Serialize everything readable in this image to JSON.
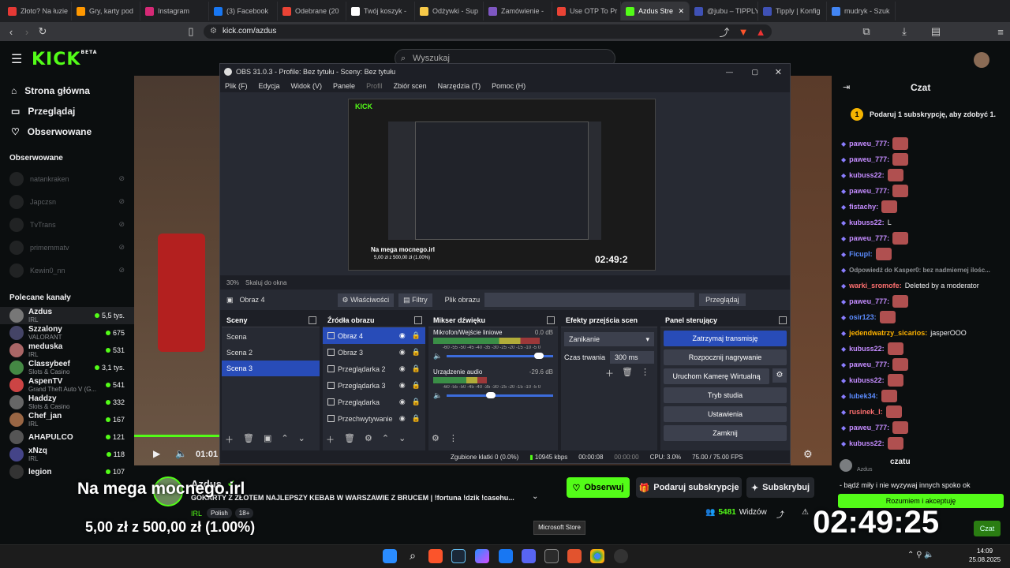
{
  "browser": {
    "tabs": [
      {
        "label": "Złoto? Na łuzie",
        "color": "#e53935"
      },
      {
        "label": "Gry, karty pod",
        "color": "#ff9800"
      },
      {
        "label": "Instagram",
        "color": "#d62976"
      },
      {
        "label": "(3) Facebook",
        "color": "#1877f2"
      },
      {
        "label": "Odebrane (20",
        "color": "#ea4335"
      },
      {
        "label": "Twój koszyk - ",
        "color": "#ffffff"
      },
      {
        "label": "Odżywki - Sup",
        "color": "#f7c948"
      },
      {
        "label": "Zamówienie - ",
        "color": "#7e57c2"
      },
      {
        "label": "Use OTP To Pr",
        "color": "#ea4335"
      },
      {
        "label": "Azdus Stre",
        "color": "#53fc18"
      },
      {
        "label": "@jubu – TIPPLY",
        "color": "#3f51b5"
      },
      {
        "label": "Tipply | Konfig",
        "color": "#3f51b5"
      },
      {
        "label": "mudryk - Szuk",
        "color": "#4285f4"
      }
    ],
    "url": "kick.com/azdus"
  },
  "kick": {
    "logo": "KICK",
    "logo_badge": "BETA",
    "search_placeholder": "Wyszukaj",
    "nav": [
      {
        "label": "Strona główna",
        "icon": "home-icon"
      },
      {
        "label": "Przeglądaj",
        "icon": "browse-icon"
      },
      {
        "label": "Obserwowane",
        "icon": "heart-icon"
      }
    ],
    "followed_title": "Obserwowane",
    "followed": [
      "natankraken",
      "Japczsn",
      "TvTrans",
      "primemmatv",
      "Kewin0_nn"
    ],
    "recommended_title": "Polecane kanały",
    "recommended": [
      {
        "name": "Azdus",
        "category": "IRL",
        "viewers": "5,5 tys."
      },
      {
        "name": "Szzalony",
        "category": "VALORANT",
        "viewers": "675"
      },
      {
        "name": "meduska",
        "category": "IRL",
        "viewers": "531"
      },
      {
        "name": "Classybeef",
        "category": "Slots & Casino",
        "viewers": "3,1 tys."
      },
      {
        "name": "AspenTV",
        "category": "Grand Theft Auto V (G...",
        "viewers": "541"
      },
      {
        "name": "Haddzy",
        "category": "Slots & Casino",
        "viewers": "332"
      },
      {
        "name": "Chef_jan",
        "category": "IRL",
        "viewers": "167"
      },
      {
        "name": "AHAPULCO",
        "category": "",
        "viewers": "121"
      },
      {
        "name": "xNzq",
        "category": "IRL",
        "viewers": "118"
      },
      {
        "name": "legion",
        "category": "",
        "viewers": "107"
      }
    ],
    "player_time": "01:01",
    "channel_name": "Azdus",
    "stream_title": "GOKARTY Z ZŁOTEM NAJLEPSZY KEBAB W WARSZAWIE Z BRUCEM | !fortuna !dzik !casehu...",
    "category": "IRL",
    "tags": [
      "Polish",
      "18+"
    ],
    "follow_label": "Obserwuj",
    "gift_label": "Podaruj subskrypcje",
    "subscribe_label": "Subskrybuj",
    "viewers_count": "5481",
    "viewers_label": "Widzów"
  },
  "overlay": {
    "headline": "Na mega mocnego.irl",
    "donation": "5,00 zł z 500,00 zł (1.00%)",
    "clock": "02:49:25"
  },
  "chat": {
    "title": "Czat",
    "gift_prompt": "Podaruj 1 subskrypcję, aby zdobyć 1.",
    "gift_count": "1",
    "messages": [
      {
        "user": "paweu_777:",
        "color": "#c48cff",
        "text": ""
      },
      {
        "user": "paweu_777:",
        "color": "#c48cff",
        "text": ""
      },
      {
        "user": "kubuss22:",
        "color": "#c48cff",
        "text": ""
      },
      {
        "user": "paweu_777:",
        "color": "#c48cff",
        "text": ""
      },
      {
        "user": "fistachy:",
        "color": "#c48cff",
        "text": ""
      },
      {
        "user": "kubuss22:",
        "color": "#c48cff",
        "text": "L"
      },
      {
        "user": "paweu_777:",
        "color": "#c48cff",
        "text": ""
      },
      {
        "user": "Ficupl:",
        "color": "#5c8cff",
        "text": ""
      },
      {
        "user": "Odpowiedź do Kasper0: bez nadmiernej ilośc...",
        "color": "#8f9296",
        "text": ""
      },
      {
        "user": "warki_sromofe:",
        "color": "#ff7070",
        "text": "Deleted by a moderator"
      },
      {
        "user": "paweu_777:",
        "color": "#c48cff",
        "text": ""
      },
      {
        "user": "osir123:",
        "color": "#5c8cff",
        "text": ""
      },
      {
        "user": "jedendwatrzy_sicarios:",
        "color": "#ffb300",
        "text": "jasperOOO"
      },
      {
        "user": "kubuss22:",
        "color": "#c48cff",
        "text": ""
      },
      {
        "user": "paweu_777:",
        "color": "#c48cff",
        "text": ""
      },
      {
        "user": "kubuss22:",
        "color": "#c48cff",
        "text": ""
      },
      {
        "user": "lubek34:",
        "color": "#5c8cff",
        "text": ""
      },
      {
        "user": "rusinek_l:",
        "color": "#ff7070",
        "text": ""
      },
      {
        "user": "paweu_777:",
        "color": "#c48cff",
        "text": ""
      },
      {
        "user": "kubuss22:",
        "color": "#c48cff",
        "text": ""
      }
    ],
    "rules_title": "czatu",
    "rules_user": "Azdus",
    "rules_text": "- bądź miły i nie wyzywaj innych spoko ok",
    "accept_label": "Rozumiem i akceptuję",
    "chat_button": "Czat"
  },
  "obs": {
    "title": "OBS 31.0.3 - Profile: Bez tytułu - Sceny: Bez tytułu",
    "menu": [
      "Plik (F)",
      "Edycja",
      "Widok (V)",
      "Panele",
      "Profil",
      "Zbiór scen",
      "Narzędzia (T)",
      "Pomoc (H)"
    ],
    "zoom": "30%",
    "scale_label": "Skaluj do okna",
    "preview_overlay_text": "Na mega mocnego.irl",
    "preview_donation": "5,00 zł z 500,00 zł (1.00%)",
    "preview_clock": "02:49:2",
    "selected_source": "Obraz 4",
    "properties_label": "Właściwości",
    "filters_label": "Filtry",
    "image_file_label": "Plik obrazu",
    "browse_label": "Przeglądaj",
    "scenes_title": "Sceny",
    "scenes": [
      "Scena",
      "Scena 2",
      "Scena 3"
    ],
    "sources_title": "Źródła obrazu",
    "sources": [
      "Obraz 4",
      "Obraz 3",
      "Przeglądarka 2",
      "Przeglądarka 3",
      "Przeglądarka",
      "Przechwytywanie"
    ],
    "mixer_title": "Mikser dźwięku",
    "mixer": [
      {
        "name": "Mikrofon/Wejście liniowe",
        "db": "0.0 dB",
        "level": 0.9
      },
      {
        "name": "Urządzenie audio",
        "db": "-29.6 dB",
        "level": 0.45
      }
    ],
    "meter_scale": "-60 -55 -50 -45 -40 -35 -30 -25 -20 -15 -10 -5 0",
    "transitions_title": "Efekty przejścia scen",
    "transition": "Zanikanie",
    "duration_label": "Czas trwania",
    "duration": "300 ms",
    "controls_title": "Panel sterujący",
    "controls": [
      "Zatrzymaj transmisję",
      "Rozpocznij nagrywanie",
      "Uruchom Kamerę Wirtualną",
      "Tryb studia",
      "Ustawienia",
      "Zamknij"
    ],
    "status": {
      "dropped": "Zgubione klatki 0 (0.0%)",
      "bitrate": "10945 kbps",
      "stream_time": "00:00:08",
      "rec_time": "00:00:00",
      "cpu": "CPU: 3.0%",
      "fps": "75.00 / 75.00 FPS"
    }
  },
  "taskbar": {
    "tooltip": "Microsoft Store",
    "time": "14:09",
    "date": "25.08.2025"
  },
  "colors": {
    "kick_green": "#53fc18",
    "obs_blue": "#284cb8"
  }
}
